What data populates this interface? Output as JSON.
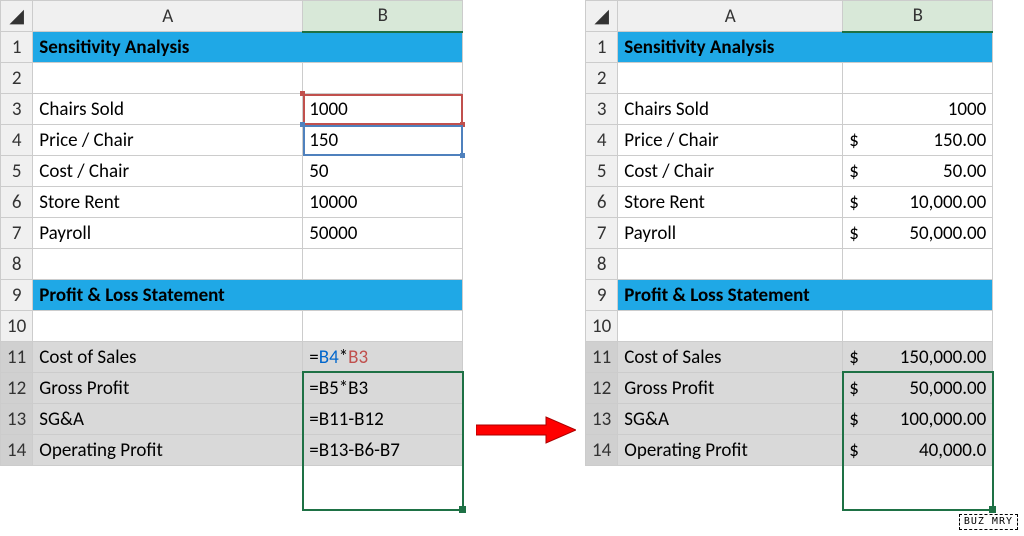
{
  "columns": {
    "sel": "◢",
    "A": "A",
    "B": "B"
  },
  "rows": [
    "1",
    "2",
    "3",
    "4",
    "5",
    "6",
    "7",
    "8",
    "9",
    "10",
    "11",
    "12",
    "13",
    "14"
  ],
  "left": {
    "title1": "Sensitivity Analysis",
    "r3a": "Chairs Sold",
    "r3b": "1000",
    "r4a": "Price / Chair",
    "r4b": "150",
    "r5a": "Cost / Chair",
    "r5b": "50",
    "r6a": "Store Rent",
    "r6b": "10000",
    "r7a": "Payroll",
    "r7b": "50000",
    "title2": "Profit & Loss Statement",
    "r11a": "Cost of Sales",
    "r11b_eq": "=",
    "r11b_p1": "B4",
    "r11b_op": "*",
    "r11b_p2": "B3",
    "r12a": "Gross Profit",
    "r12b": "=B5*B3",
    "r13a": "SG&A",
    "r13b": "=B11-B12",
    "r14a": "Operating Profit",
    "r14b": "=B13-B6-B7"
  },
  "right": {
    "title1": "Sensitivity Analysis",
    "r3a": "Chairs Sold",
    "r3b": "1000",
    "r4a": "Price / Chair",
    "r4s": "$",
    "r4b": "150.00",
    "r5a": "Cost / Chair",
    "r5s": "$",
    "r5b": "50.00",
    "r6a": "Store Rent",
    "r6s": "$",
    "r6b": "10,000.00",
    "r7a": "Payroll",
    "r7s": "$",
    "r7b": "50,000.00",
    "title2": "Profit & Loss Statement",
    "r11a": "Cost of Sales",
    "r11s": "$",
    "r11b": "150,000.00",
    "r12a": "Gross Profit",
    "r12s": "$",
    "r12b": "50,000.00",
    "r13a": "SG&A",
    "r13s": "$",
    "r13b": "100,000.00",
    "r14a": "Operating Profit",
    "r14s": "$",
    "r14b": "40,000.0"
  },
  "watermark": "BUZ\nMRY",
  "chart_data": {
    "type": "table",
    "title": "Sensitivity Analysis / Profit & Loss Statement",
    "inputs": {
      "Chairs Sold": 1000,
      "Price / Chair": 150.0,
      "Cost / Chair": 50.0,
      "Store Rent": 10000.0,
      "Payroll": 50000.0
    },
    "formulas": {
      "Cost of Sales": "=B4*B3",
      "Gross Profit": "=B5*B3",
      "SG&A": "=B11-B12",
      "Operating Profit": "=B13-B6-B7"
    },
    "results": {
      "Cost of Sales": 150000.0,
      "Gross Profit": 50000.0,
      "SG&A": 100000.0,
      "Operating Profit": 40000.0
    }
  }
}
